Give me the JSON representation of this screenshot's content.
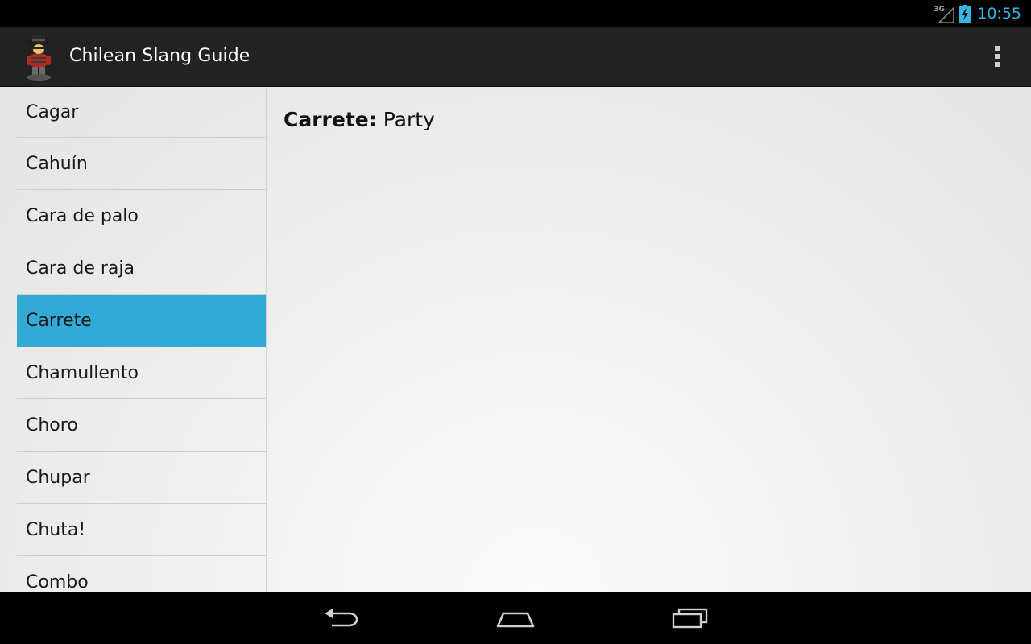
{
  "status_bar": {
    "network_label": "3G",
    "time": "10:55",
    "icons": [
      "signal-icon",
      "battery-charging-icon"
    ],
    "time_color": "#33b5e5"
  },
  "action_bar": {
    "title": "Chilean Slang Guide",
    "app_icon": "bandit-character-icon",
    "overflow_icon": "more-vert-icon"
  },
  "term_list": {
    "items": [
      "Cagar",
      "Cahuín",
      "Cara de palo",
      "Cara de raja",
      "Carrete",
      "Chamullento",
      "Choro",
      "Chupar",
      "Chuta!",
      "Combo"
    ],
    "selected_index": 4,
    "selected_color": "#33a9d6"
  },
  "detail": {
    "term": "Carrete:",
    "definition": " Party"
  },
  "nav_bar": {
    "icons": [
      "back-icon",
      "home-icon",
      "recent-apps-icon"
    ]
  }
}
